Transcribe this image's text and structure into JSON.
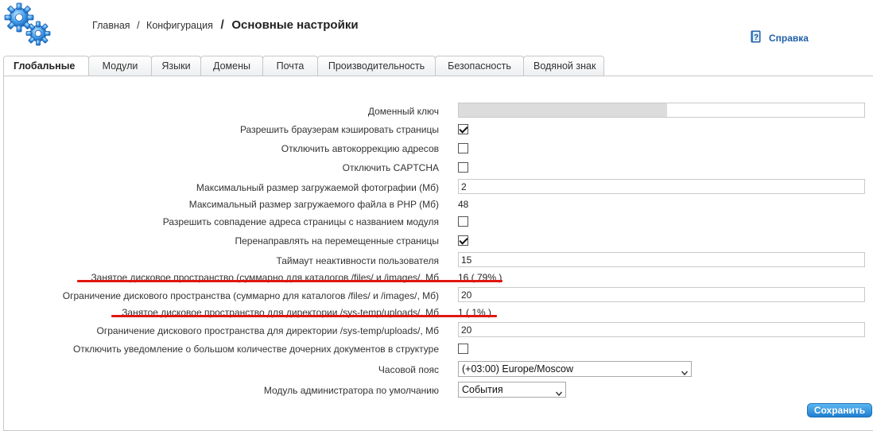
{
  "header": {
    "breadcrumb": {
      "home": "Главная",
      "sep1": "/",
      "config": "Конфигурация",
      "sep2": "/",
      "current": "Основные настройки"
    },
    "help_label": "Справка"
  },
  "tabs": [
    {
      "label": "Глобальные",
      "active": true
    },
    {
      "label": "Модули"
    },
    {
      "label": "Языки"
    },
    {
      "label": "Домены"
    },
    {
      "label": "Почта"
    },
    {
      "label": "Производительность"
    },
    {
      "label": "Безопасность"
    },
    {
      "label": "Водяной знак"
    }
  ],
  "form": {
    "domain_key": {
      "label": "Доменный ключ",
      "value": ""
    },
    "browser_cache": {
      "label": "Разрешить браузерам кэшировать страницы",
      "checked": true
    },
    "disable_autocorrect": {
      "label": "Отключить автокоррекцию адресов",
      "checked": false
    },
    "disable_captcha": {
      "label": "Отключить CAPTCHA",
      "checked": false
    },
    "max_photo_size": {
      "label": "Максимальный размер загружаемой фотографии (Мб)",
      "value": "2"
    },
    "max_php_upload": {
      "label": "Максимальный размер загружаемого файла в PHP (Мб)",
      "value": "48"
    },
    "allow_module_match": {
      "label": "Разрешить совпадение адреса страницы с названием модуля",
      "checked": false
    },
    "redirect_moved": {
      "label": "Перенаправлять на перемещенные страницы",
      "checked": true
    },
    "inactivity_timeout": {
      "label": "Таймаут неактивности пользователя",
      "value": "15"
    },
    "disk_used_files": {
      "label": "Занятое дисковое пространство (суммарно для каталогов /files/ и /images/, Мб",
      "value": "16 ( 79% )"
    },
    "disk_limit_files": {
      "label": "Ограничение дискового пространства (суммарно для каталогов /files/ и /images/, Мб)",
      "value": "20"
    },
    "disk_used_uploads": {
      "label": "Занятое дисковое пространство для директории /sys-temp/uploads/, Мб",
      "value": "1 ( 1% )"
    },
    "disk_limit_uploads": {
      "label": "Ограничение дискового пространства для директории /sys-temp/uploads/, Мб",
      "value": "20"
    },
    "disable_children_notice": {
      "label": "Отключить уведомление о большом количестве дочерних документов в структуре",
      "checked": false
    },
    "timezone": {
      "label": "Часовой пояс",
      "value": "(+03:00) Europe/Moscow"
    },
    "default_admin_module": {
      "label": "Модуль администратора по умолчанию",
      "value": "События"
    }
  },
  "actions": {
    "save_label": "Сохранить"
  },
  "colors": {
    "accent": "#1f7fd0",
    "annotation": "#e0170f",
    "link": "#1f5fa8"
  }
}
